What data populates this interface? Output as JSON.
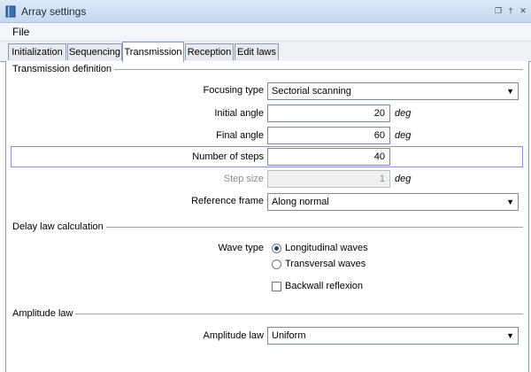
{
  "window": {
    "title": "Array settings"
  },
  "menu": {
    "file": "File"
  },
  "tabs": [
    {
      "label": "Initialization"
    },
    {
      "label": "Sequencing"
    },
    {
      "label": "Transmission",
      "active": true
    },
    {
      "label": "Reception"
    },
    {
      "label": "Edit laws"
    }
  ],
  "transmission_definition": {
    "section_title": "Transmission definition",
    "focusing_type": {
      "label": "Focusing type",
      "value": "Sectorial scanning"
    },
    "initial_angle": {
      "label": "Initial angle",
      "value": "20",
      "unit": "deg"
    },
    "final_angle": {
      "label": "Final angle",
      "value": "60",
      "unit": "deg"
    },
    "number_of_steps": {
      "label": "Number of steps",
      "value": "40"
    },
    "step_size": {
      "label": "Step size",
      "value": "1",
      "unit": "deg",
      "disabled": true
    },
    "reference_frame": {
      "label": "Reference frame",
      "value": "Along normal"
    }
  },
  "delay_law": {
    "section_title": "Delay law calculation",
    "wave_type_label": "Wave type",
    "options": [
      {
        "label": "Longitudinal waves",
        "selected": true
      },
      {
        "label": "Transversal waves",
        "selected": false
      }
    ],
    "backwall": {
      "label": "Backwall reflexion",
      "checked": false
    }
  },
  "amplitude": {
    "section_title": "Amplitude law",
    "law": {
      "label": "Amplitude law",
      "value": "Uniform"
    }
  },
  "colors": {
    "accent": "#8b93d8",
    "titlebar": "#c6d8ee"
  },
  "icons": {
    "app": "book-icon",
    "restore": "restore-icon",
    "pin": "pin-icon",
    "close": "close-icon"
  }
}
